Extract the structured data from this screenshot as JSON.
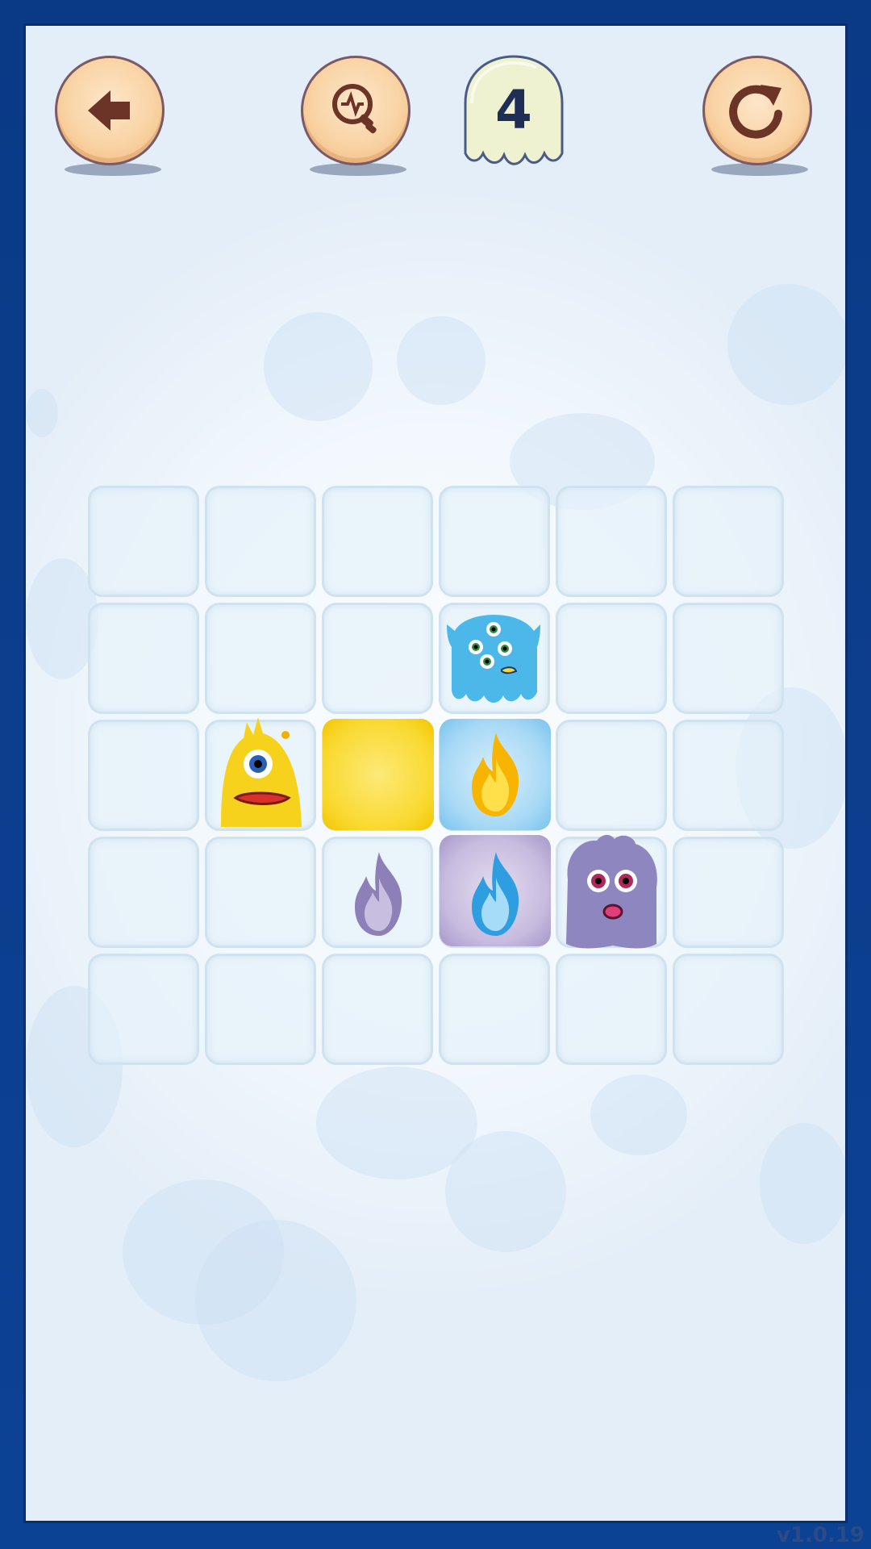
{
  "header": {
    "back_icon": "back-arrow-icon",
    "hint_icon": "lightbulb-hint-icon",
    "moves_count": "4",
    "restart_icon": "restart-icon"
  },
  "board": {
    "rows": 5,
    "cols": 6,
    "pieces": [
      {
        "row": 2,
        "col": 4,
        "type": "blue-monster"
      },
      {
        "row": 3,
        "col": 2,
        "type": "yellow-monster"
      },
      {
        "row": 3,
        "col": 3,
        "type": "yellow-tile"
      },
      {
        "row": 3,
        "col": 4,
        "type": "yellow-flame-on-blue-tile"
      },
      {
        "row": 4,
        "col": 3,
        "type": "purple-flame"
      },
      {
        "row": 4,
        "col": 4,
        "type": "blue-flame-on-purple-tile"
      },
      {
        "row": 4,
        "col": 5,
        "type": "purple-monster"
      }
    ]
  },
  "colors": {
    "frame": "#0b3d8c",
    "button": "#f9d3a4",
    "yellow": "#f9d92f",
    "blue": "#79c2ee",
    "purple": "#a697c8"
  },
  "version": "v1.0.19"
}
